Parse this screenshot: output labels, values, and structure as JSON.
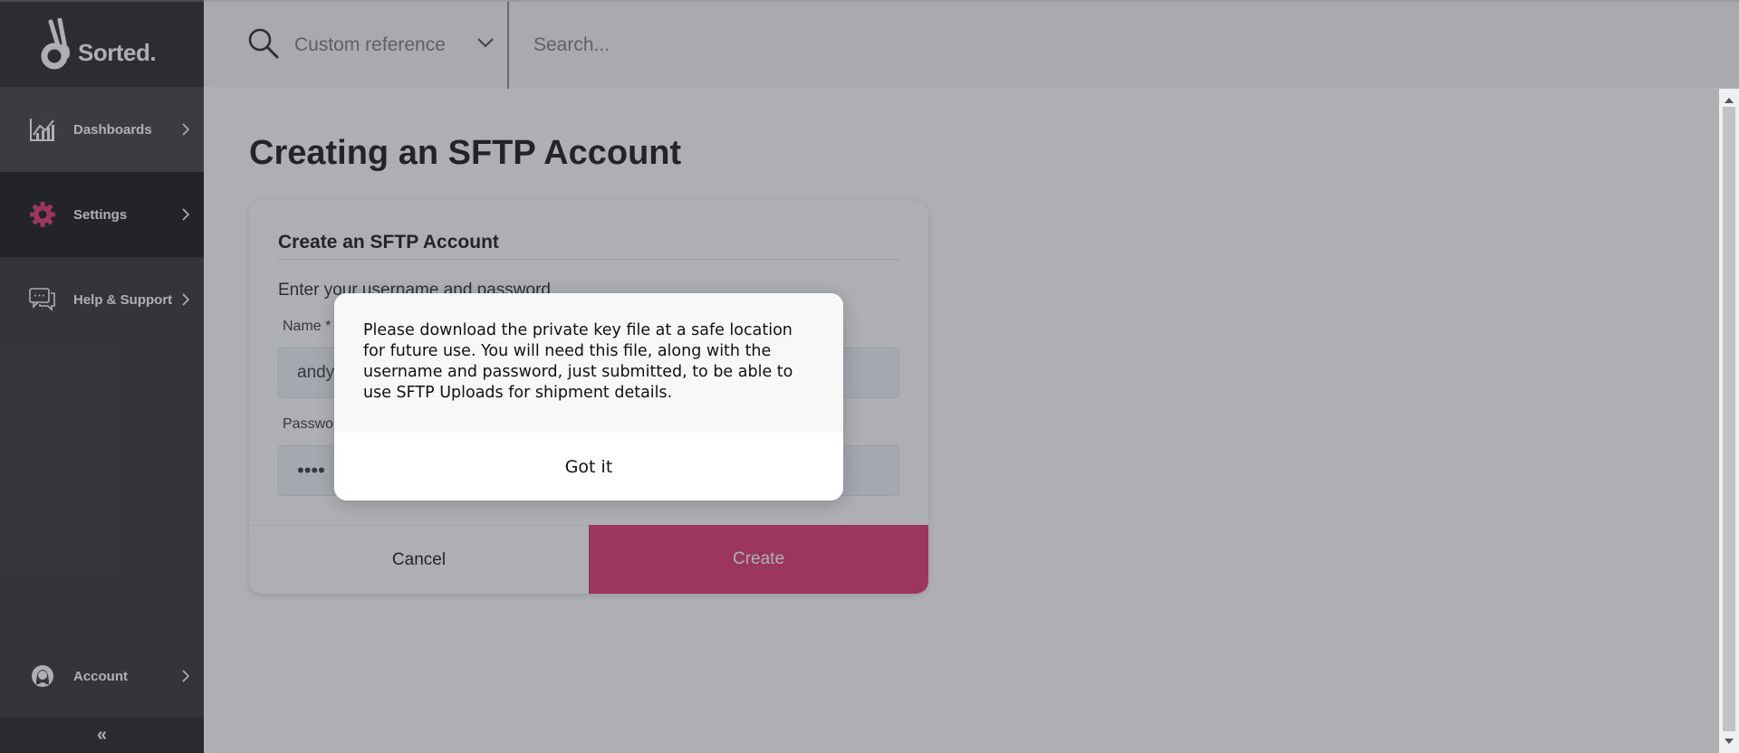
{
  "app": {
    "logo_text": "Sorted."
  },
  "sidebar": {
    "items": [
      {
        "label": "Dashboards",
        "icon": "chart-icon"
      },
      {
        "label": "Settings",
        "icon": "gear-icon"
      },
      {
        "label": "Help & Support",
        "icon": "chat-icon"
      }
    ],
    "account_label": "Account",
    "collapse_label": "«"
  },
  "topbar": {
    "reference_select": "Custom reference",
    "search_placeholder": "Search..."
  },
  "page": {
    "title": "Creating an SFTP Account"
  },
  "form": {
    "title": "Create an SFTP Account",
    "subtitle": "Enter your username and password",
    "name_label": "Name *",
    "name_value": "andy",
    "password_label": "Password",
    "password_value": "••••",
    "cancel_label": "Cancel",
    "create_label": "Create"
  },
  "dialog": {
    "message": "Please download the private key file at a safe location for future use. You will need this file, along with the username and password, just submitted, to be able to use SFTP Uploads for shipment details.",
    "button_label": "Got it"
  },
  "colors": {
    "accent": "#e0306e",
    "sidebar_bg": "#2e2e2e",
    "settings_icon": "#e0306e"
  }
}
